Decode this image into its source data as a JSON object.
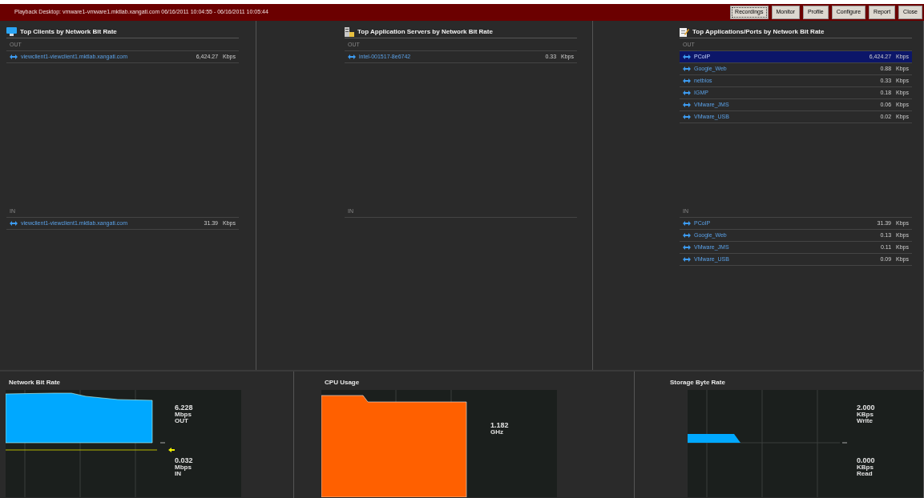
{
  "title_bar": {
    "title": "Playback Desktop: vmware1-vmware1.mktlab.xangati.com  06/16/2011 10:04:55 - 06/16/2011 10:05:44",
    "buttons": [
      {
        "label": "Recordings",
        "selected": true
      },
      {
        "label": "Monitor",
        "selected": false
      },
      {
        "label": "Profile",
        "selected": false
      },
      {
        "label": "Configure",
        "selected": false
      },
      {
        "label": "Report",
        "selected": false
      },
      {
        "label": "Close",
        "selected": false
      }
    ]
  },
  "panels": [
    {
      "title": "Top Clients by Network Bit Rate",
      "out": {
        "label": "OUT",
        "rows": [
          {
            "name": "viewclient1-viewclient1.mktlab.xangati.com",
            "value": "6,424.27",
            "unit": "Kbps",
            "selected": false
          }
        ]
      },
      "in": {
        "label": "IN",
        "rows": [
          {
            "name": "viewclient1-viewclient1.mktlab.xangati.com",
            "value": "31.39",
            "unit": "Kbps",
            "selected": false
          }
        ]
      }
    },
    {
      "title": "Top Application Servers by Network Bit Rate",
      "out": {
        "label": "OUT",
        "rows": [
          {
            "name": "intel-001517-8e6742",
            "value": "0.33",
            "unit": "Kbps",
            "selected": false
          }
        ]
      },
      "in": {
        "label": "IN"
      }
    },
    {
      "title": "Top Applications/Ports by Network Bit Rate",
      "out": {
        "label": "OUT",
        "rows": [
          {
            "name": "PCoIP",
            "value": "6,424.27",
            "unit": "Kbps",
            "selected": true
          },
          {
            "name": "Google_Web",
            "value": "0.88",
            "unit": "Kbps",
            "selected": false
          },
          {
            "name": "netbios",
            "value": "0.33",
            "unit": "Kbps",
            "selected": false
          },
          {
            "name": "IGMP",
            "value": "0.18",
            "unit": "Kbps",
            "selected": false
          },
          {
            "name": "VMware_JMS",
            "value": "0.06",
            "unit": "Kbps",
            "selected": false
          },
          {
            "name": "VMware_USB",
            "value": "0.02",
            "unit": "Kbps",
            "selected": false
          }
        ]
      },
      "in": {
        "label": "IN",
        "rows": [
          {
            "name": "PCoIP",
            "value": "31.39",
            "unit": "Kbps",
            "selected": false
          },
          {
            "name": "Google_Web",
            "value": "0.13",
            "unit": "Kbps",
            "selected": false
          },
          {
            "name": "VMware_JMS",
            "value": "0.11",
            "unit": "Kbps",
            "selected": false
          },
          {
            "name": "VMware_USB",
            "value": "0.09",
            "unit": "Kbps",
            "selected": false
          }
        ]
      }
    }
  ],
  "charts": [
    {
      "title": "Network Bit Rate",
      "kind": "network",
      "readings": [
        [
          "6.228",
          "Mbps",
          "OUT"
        ],
        [
          "0.032",
          "Mbps",
          "IN"
        ]
      ]
    },
    {
      "title": "CPU Usage",
      "kind": "cpu",
      "readings": [
        [
          "1.182",
          "GHz"
        ]
      ]
    },
    {
      "title": "Storage Byte Rate",
      "kind": "storage",
      "readings": [
        [
          "2.000",
          "KBps",
          "Write"
        ],
        [
          "0.000",
          "KBps",
          "Read"
        ]
      ]
    }
  ]
}
